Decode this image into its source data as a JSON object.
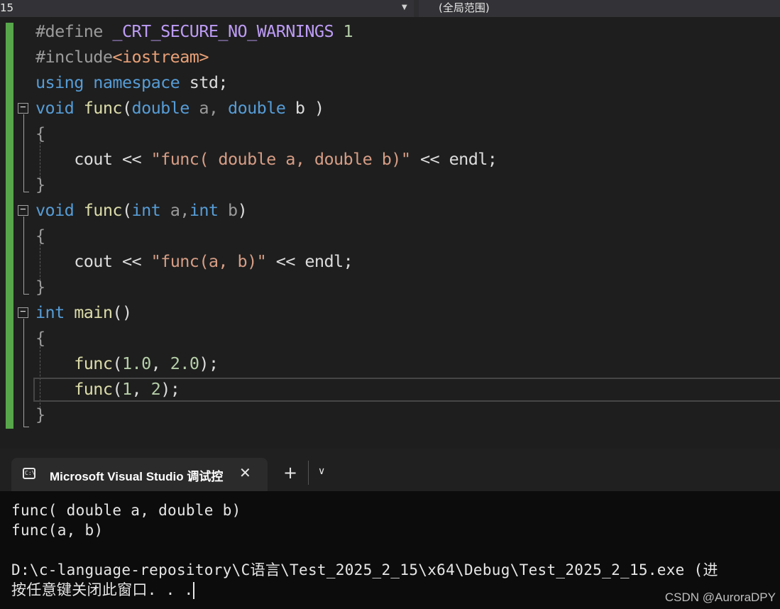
{
  "navbar": {
    "project_fragment": "15",
    "scope": "(全局范围)"
  },
  "code": {
    "line1": {
      "directive": "#define ",
      "macro": "_CRT_SECURE_NO_WARNINGS",
      "value": " 1"
    },
    "line2": {
      "directive": "#include",
      "header": "<iostream>"
    },
    "line3": {
      "kw1": "using",
      "kw2": " namespace",
      "rest": " std;"
    },
    "line4": {
      "kw": "void",
      "fn": " func",
      "p1": "(",
      "t1": "double",
      "a": " a, ",
      "t2": "double",
      "b": " b ",
      "p2": ")"
    },
    "brace_open": "{",
    "brace_close": "}",
    "line6": {
      "cout": "cout << ",
      "str": "\"func( double a, double b)\"",
      "end": " << endl;"
    },
    "line8": {
      "kw": "void",
      "fn": " func",
      "p1": "(",
      "t1": "int",
      "a": " a,",
      "t2": "int",
      "b": " b",
      "p2": ")"
    },
    "line10": {
      "cout": "cout << ",
      "str": "\"func(a, b)\"",
      "end": " << endl;"
    },
    "line12": {
      "kw": "int",
      "fn": " main",
      "p": "()"
    },
    "line14": {
      "fn": "func",
      "p1": "(",
      "n1": "1.0",
      "c": ", ",
      "n2": "2.0",
      "p2": ");"
    },
    "line15": {
      "fn": "func",
      "p1": "(",
      "n1": "1",
      "c": ", ",
      "n2": "2",
      "p2": ");"
    }
  },
  "terminal": {
    "tab_title": "Microsoft Visual Studio 调试控",
    "tab_icon_text": "C:\\",
    "lines": [
      "func( double a, double b)",
      "func(a, b)",
      "",
      "D:\\c-language-repository\\C语言\\Test_2025_2_15\\x64\\Debug\\Test_2025_2_15.exe (进",
      "按任意键关闭此窗口. . ."
    ]
  },
  "watermark": "CSDN @AuroraDPY"
}
